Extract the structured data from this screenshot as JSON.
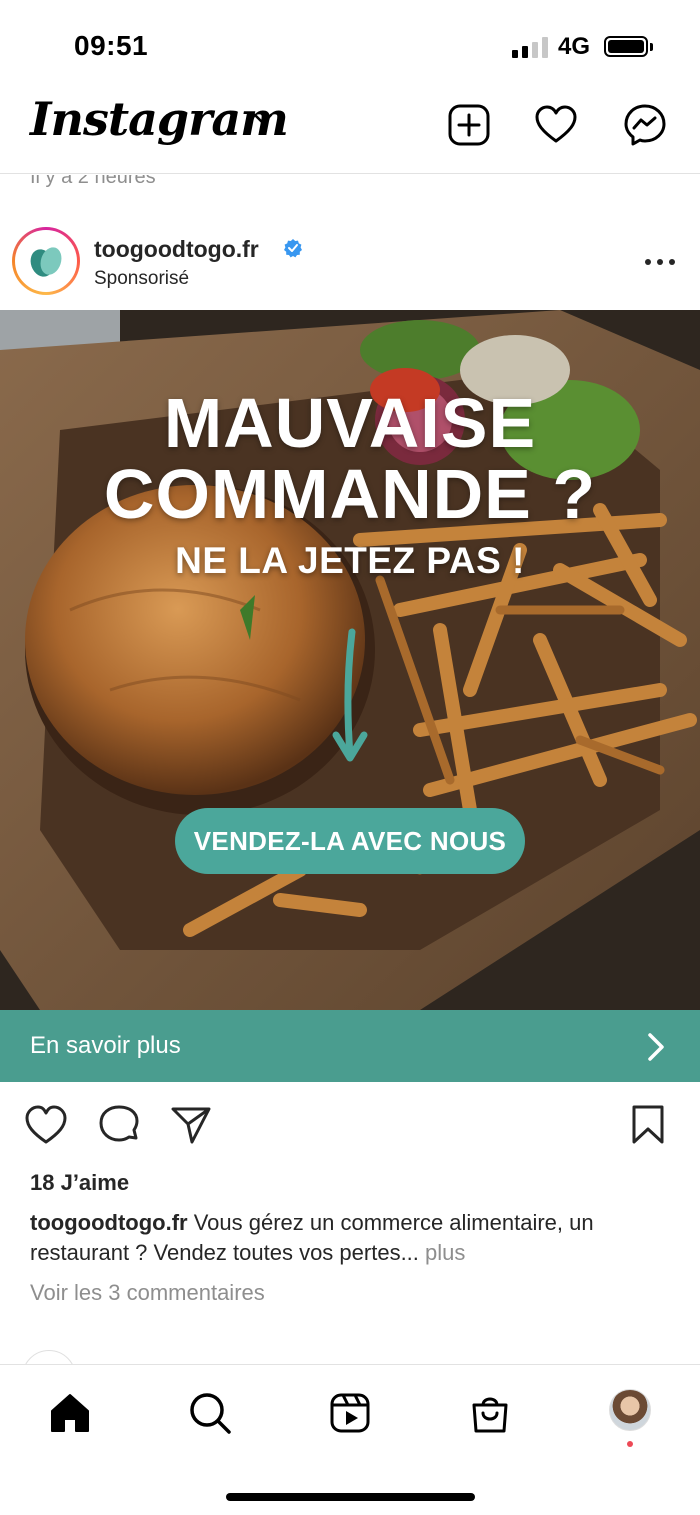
{
  "status_bar": {
    "time": "09:51",
    "network": "4G"
  },
  "header": {
    "logo_text": "Instagram"
  },
  "previous_post": {
    "timestamp": "Il y a 2 heures"
  },
  "post": {
    "username": "toogoodtogo.fr",
    "sponsored_label": "Sponsorisé",
    "headline_line1": "MAUVAISE",
    "headline_line2": "COMMANDE ?",
    "subheadline": "NE LA JETEZ PAS !",
    "image_cta": "VENDEZ-LA AVEC NOUS",
    "cta_bar_label": "En savoir plus",
    "likes": "18 J’aime",
    "caption_user": "toogoodtogo.fr",
    "caption_text": " Vous gérez un commerce alimentaire, un restaurant ? Vendez toutes vos pertes...",
    "caption_more": " plus",
    "view_comments": "Voir les 3 commentaires",
    "brand_color": "#4a9d8f"
  },
  "icons": {
    "header": [
      "chevron-down-icon",
      "new-post-icon",
      "heart-icon",
      "messenger-icon"
    ],
    "actions": [
      "like-icon",
      "comment-icon",
      "share-icon",
      "bookmark-icon"
    ],
    "nav": [
      "home-icon",
      "search-icon",
      "reels-icon",
      "shop-icon",
      "profile-avatar"
    ]
  }
}
